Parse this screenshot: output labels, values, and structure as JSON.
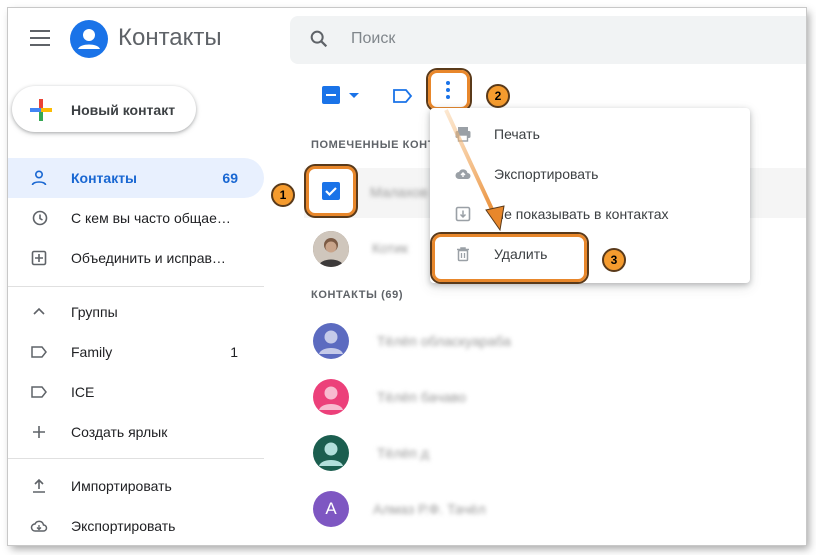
{
  "header": {
    "app_title": "Контакты",
    "search_placeholder": "Поиск"
  },
  "new_contact_label": "Новый контакт",
  "sidebar": {
    "items": [
      {
        "label": "Контакты",
        "count": "69",
        "icon": "person-icon",
        "active": true
      },
      {
        "label": "С кем вы часто общае…",
        "icon": "history-icon"
      },
      {
        "label": "Объединить и исправ…",
        "icon": "merge-icon"
      }
    ],
    "groups_label": "Группы",
    "labels": [
      {
        "label": "Family",
        "count": "1",
        "icon": "label-icon"
      },
      {
        "label": "ICE",
        "count": "",
        "icon": "label-icon"
      }
    ],
    "create_label": "Создать ярлык",
    "import_label": "Импортировать",
    "export_label": "Экспортировать"
  },
  "list": {
    "starred_header": "ПОМЕЧЕННЫЕ КОНТ",
    "contacts_header": "КОНТАКТЫ (69)",
    "starred": [
      {
        "name": "Малахов",
        "selected": true
      },
      {
        "name": "Котик",
        "selected": false
      }
    ],
    "contacts": [
      {
        "name": "Тёлёп обласкуараба",
        "avatar_color": "#5c6bc0"
      },
      {
        "name": "Тёлёп бачаво",
        "avatar_color": "#ec407a"
      },
      {
        "name": "Тёлёп д",
        "avatar_color": "#1b5e4f"
      },
      {
        "name": "Алмаз Р.Ф. Тачёл",
        "avatar_color": "#7e57c2",
        "initial": "A"
      }
    ]
  },
  "dropdown": {
    "items": [
      {
        "label": "Печать",
        "icon": "print-icon"
      },
      {
        "label": "Экспортировать",
        "icon": "cloud-upload-icon"
      },
      {
        "label": "Не показывать в контактах",
        "icon": "archive-icon"
      },
      {
        "label": "Удалить",
        "icon": "trash-icon"
      }
    ]
  },
  "annotations": [
    "1",
    "2",
    "3"
  ],
  "colors": {
    "accent": "#1a73e8",
    "highlight": "#e8872b",
    "badge": "#f59b2e"
  }
}
